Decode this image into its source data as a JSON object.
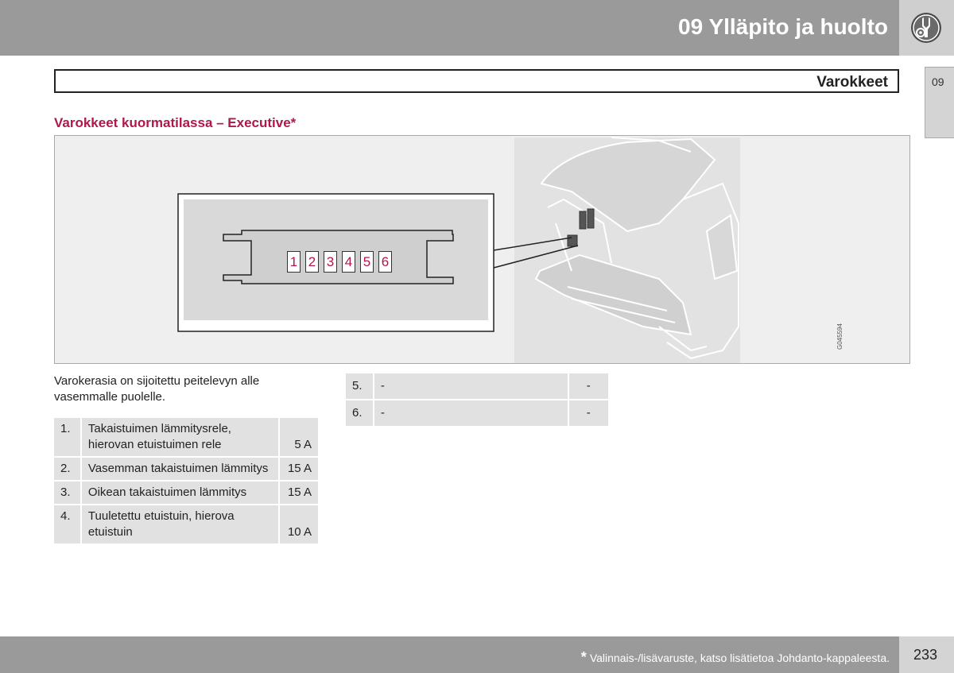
{
  "header": {
    "chapter_title": "09 Ylläpito ja huolto",
    "icon": "wrench-gear-icon"
  },
  "chapter_tab": "09",
  "section_title": "Varokkeet",
  "subheading": "Varokkeet kuormatilassa – Executive*",
  "figure": {
    "fuse_numbers": [
      "1",
      "2",
      "3",
      "4",
      "5",
      "6"
    ],
    "image_code": "G045594"
  },
  "intro_text": "Varokerasia on sijoitettu peitelevyn alle vasemmalle puolelle.",
  "fuses_left": [
    {
      "num": "1.",
      "desc": "Takaistuimen lämmitysrele, hierovan etuistuimen rele",
      "amp": "5 A"
    },
    {
      "num": "2.",
      "desc": "Vasemman takaistuimen lämmitys",
      "amp": "15 A"
    },
    {
      "num": "3.",
      "desc": "Oikean takaistuimen lämmitys",
      "amp": "15 A"
    },
    {
      "num": "4.",
      "desc": "Tuuletettu etuistuin, hierova etuistuin",
      "amp": "10 A"
    }
  ],
  "fuses_right": [
    {
      "num": "5.",
      "desc": "-",
      "amp": "-"
    },
    {
      "num": "6.",
      "desc": "-",
      "amp": "-"
    }
  ],
  "footer": {
    "note_star": "*",
    "note": "Valinnais-/lisävaruste, katso lisätietoa Johdanto-kappaleesta.",
    "page_number": "233"
  },
  "colors": {
    "accent": "#b0174b",
    "bar_gray": "#9a9a9a",
    "cell_gray": "#e1e1e1"
  }
}
